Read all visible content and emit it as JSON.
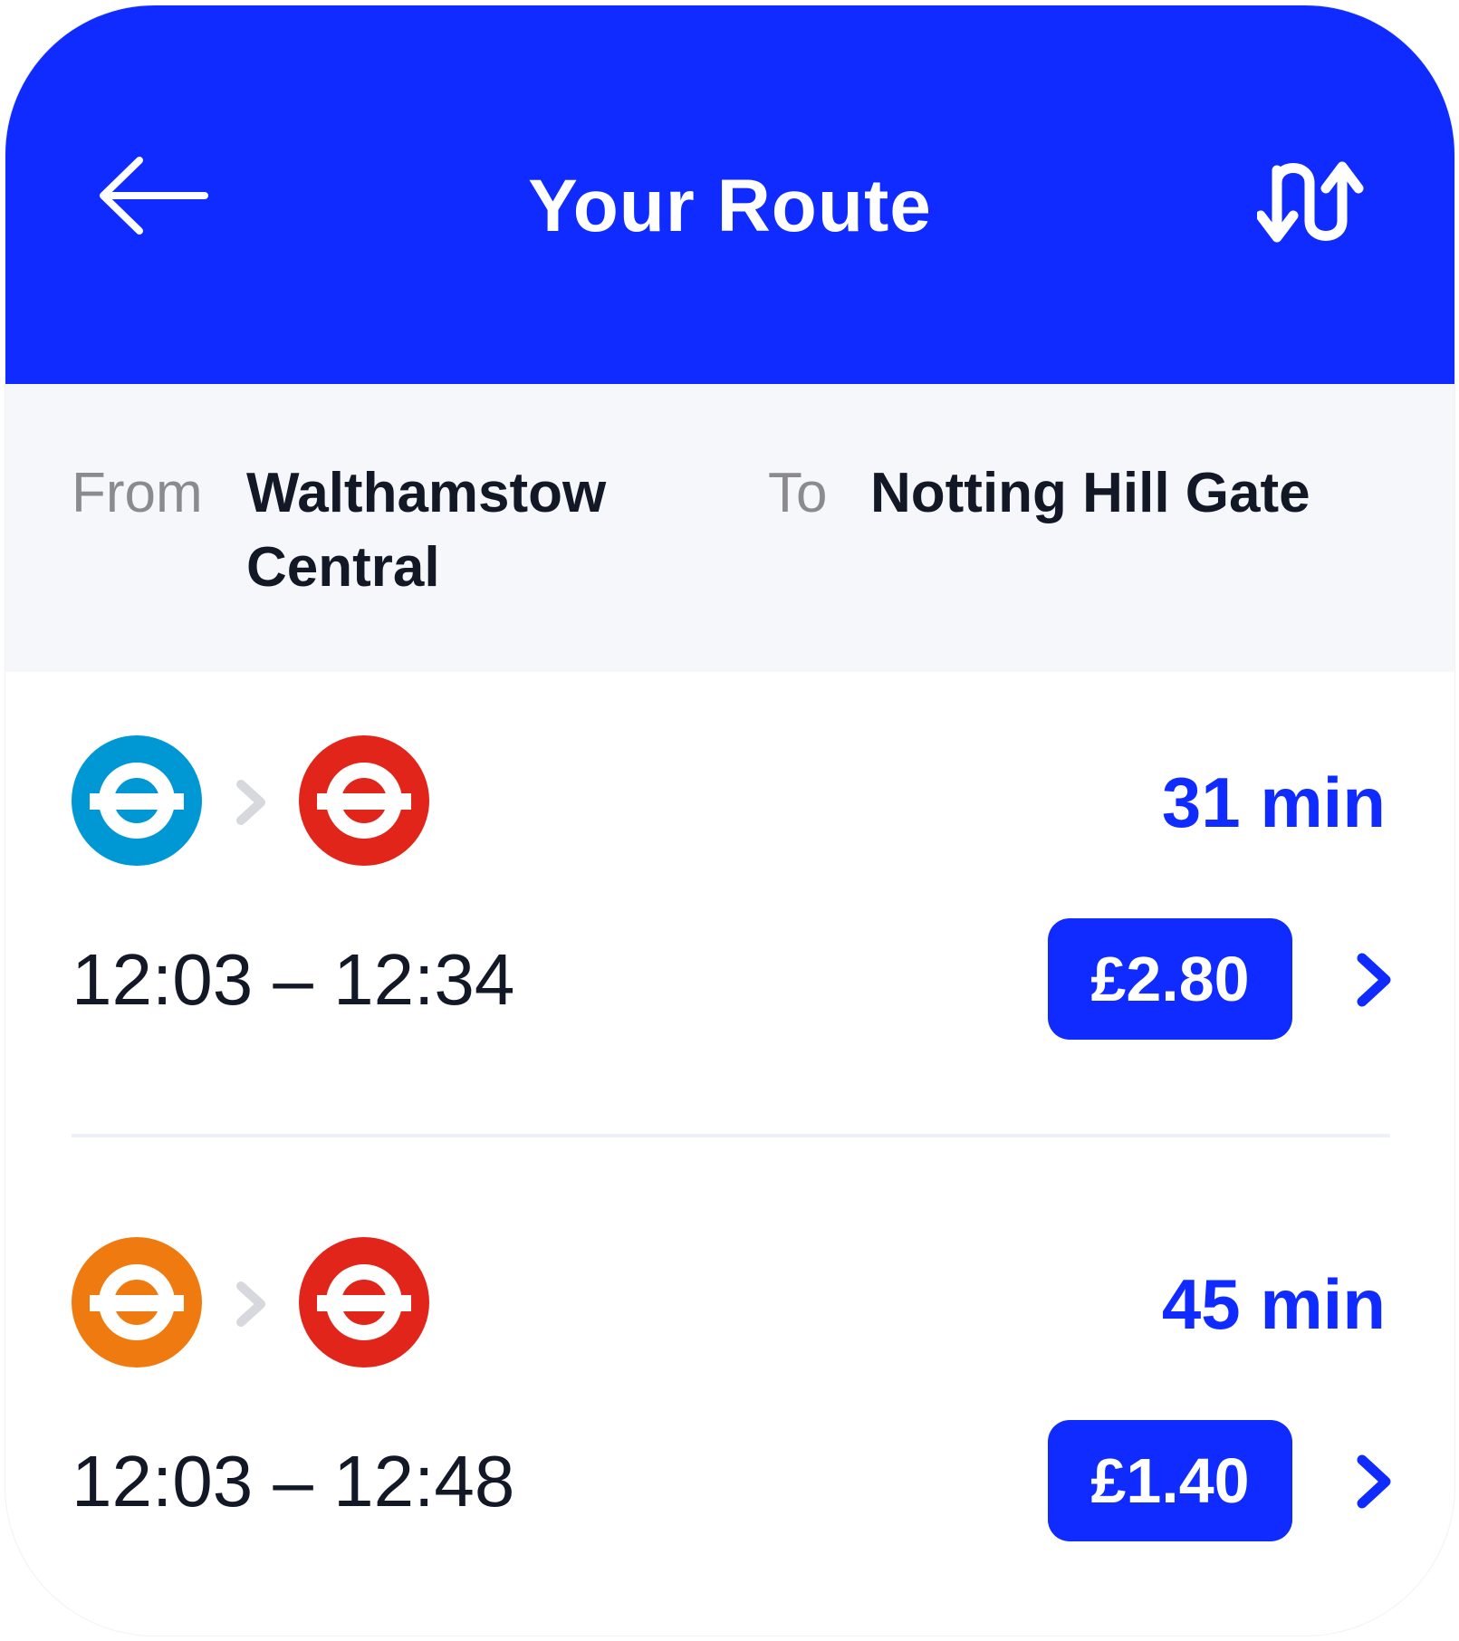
{
  "header": {
    "title": "Your Route",
    "back_icon": "arrow-left-icon",
    "swap_icon": "swap-direction-icon",
    "background": "#0f2bff"
  },
  "journey": {
    "from_label": "From",
    "from_value": "Walthamstow Central",
    "to_label": "To",
    "to_value": "Notting Hill Gate"
  },
  "routes": [
    {
      "lines": [
        {
          "icon": "underground-roundel-icon",
          "color": "#0098d4"
        },
        {
          "icon": "underground-roundel-icon",
          "color": "#e1251b"
        }
      ],
      "duration": "31 min",
      "times": "12:03 – 12:34",
      "price": "£2.80"
    },
    {
      "lines": [
        {
          "icon": "underground-roundel-icon",
          "color": "#ef7b10"
        },
        {
          "icon": "underground-roundel-icon",
          "color": "#e1251b"
        }
      ],
      "duration": "45 min",
      "times": "12:03 – 12:48",
      "price": "£1.40"
    }
  ],
  "colors": {
    "accent": "#0f2bff",
    "text_primary": "#121826",
    "text_secondary": "#8a8a8f",
    "panel_bg": "#f6f7fb"
  }
}
